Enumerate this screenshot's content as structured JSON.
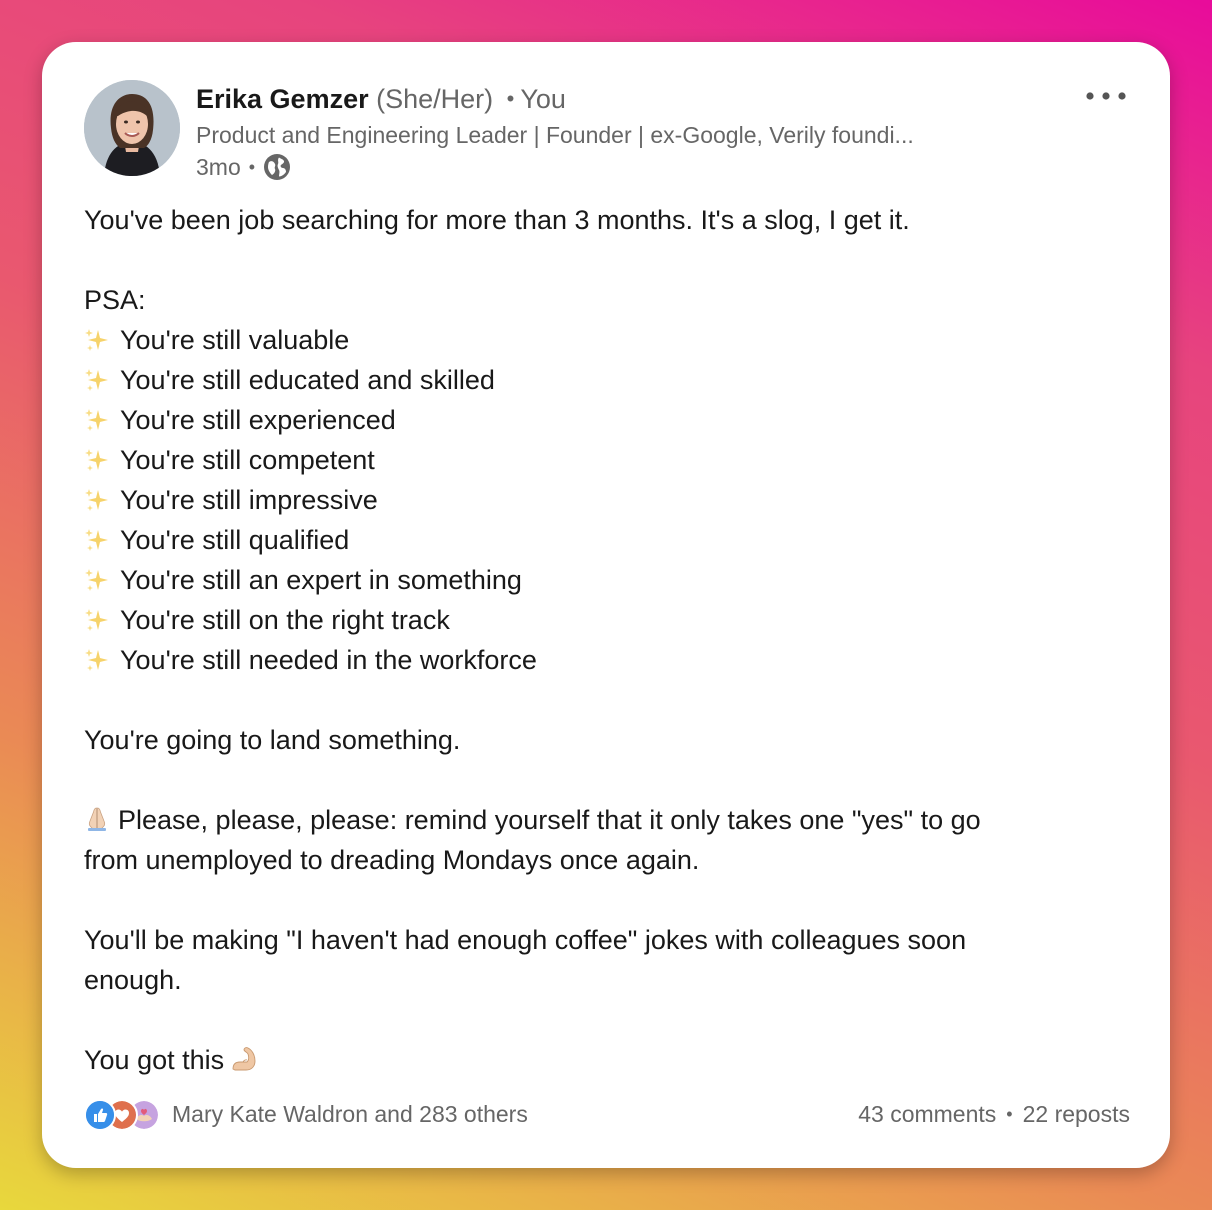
{
  "author": {
    "name": "Erika Gemzer",
    "pronouns": "(She/Her)",
    "relation": "You",
    "headline": "Product and Engineering Leader | Founder | ex-Google, Verily foundi...",
    "time": "3mo"
  },
  "post": {
    "intro": "You've been job searching for more than 3 months. It's a slog, I get it.",
    "psa": "PSA:",
    "list": [
      "You're still valuable",
      "You're still educated and skilled",
      "You're still experienced",
      "You're still competent",
      "You're still impressive",
      "You're still qualified",
      "You're still an expert in something",
      "You're still on the right track",
      "You're still needed in the workforce"
    ],
    "land": "You're going to land something.",
    "please_1": "Please, please, please: remind yourself that it only takes one \"yes\" to go",
    "please_2": "from unemployed to dreading Mondays once again.",
    "coffee_1": "You'll be making \"I haven't had enough coffee\" jokes with colleagues soon",
    "coffee_2": "enough.",
    "closing": "You got this"
  },
  "footer": {
    "reactions_text": "Mary Kate Waldron and 283 others",
    "comments": "43 comments",
    "reposts": "22 reposts"
  },
  "icons": {
    "list_bullet": "sparkle-icon",
    "please": "folded-hands-icon",
    "closing": "flexed-biceps-icon",
    "visibility": "globe-icon",
    "menu": "more-icon"
  },
  "colors": {
    "reaction_like": "#378fe9",
    "reaction_love": "#df704d",
    "reaction_support": "#c6a3e0"
  }
}
